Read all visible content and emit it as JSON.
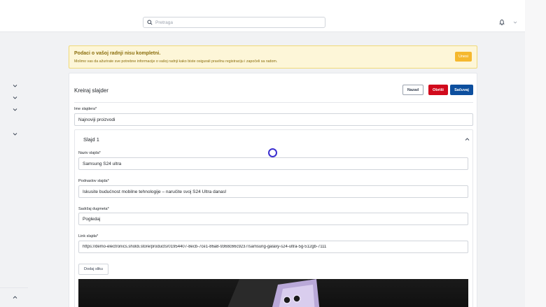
{
  "header": {
    "search_placeholder": "Pretraga"
  },
  "alert": {
    "title": "Podaci o vašoj radnji nisu kompletni.",
    "message": "Molimo vas da ažurirate sve potrebne informacije o vašoj radnji kako biste osigurali pravilnu registraciju i započeli sa radom.",
    "button_label": "Unesi"
  },
  "page": {
    "title": "Kreiraj slajder",
    "back_label": "Nazad",
    "clear_label": "Obriši",
    "save_label": "Sačuvaj"
  },
  "form": {
    "slider_name_label": "Ime slajdera*",
    "slider_name_value": "Najnoviji proizvodi",
    "slide": {
      "heading": "Slajd 1",
      "title_label": "Naziv slajda*",
      "title_value": "Samsung S24 ultra",
      "subtitle_label": "Podnaslov slajda*",
      "subtitle_value": "Iskusite budućnost mobilne tehnologije – naručite svoj S24 Ultra danas!",
      "button_text_label": "Sadržaj dugmeta*",
      "button_text_value": "Pogledaj",
      "link_label": "Link slajda*",
      "link_value": "https://demo-electronics.sholdi.store/products/01954407-8ecb-7ce1-86a8-9368c66c9237/samsung-galaxy-s24-ultra-5g-512gb-7111",
      "add_image_label": "Dodaj sliku"
    }
  },
  "colors": {
    "alert_bg": "#fdf6d8",
    "alert_button": "#f5b82e",
    "danger": "#d10a1c",
    "primary": "#0d4f9e"
  }
}
